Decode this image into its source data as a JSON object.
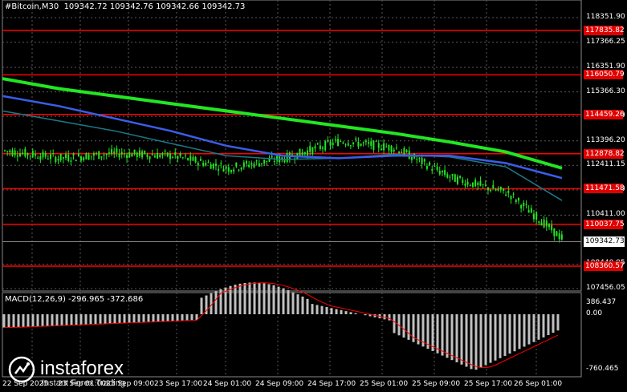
{
  "header": {
    "symbol": "#Bitcoin,M30",
    "ohlc": "109342.72 109342.76 109342.66 109342.73"
  },
  "price_axis": {
    "ticks": [
      "118351.90",
      "117366.25",
      "116351.90",
      "115366.30",
      "114381.30",
      "113396.20",
      "112411.15",
      "111426.10",
      "110411.00",
      "109342.73",
      "108440.95",
      "107456.05"
    ]
  },
  "horizontal_levels": [
    {
      "label": "117835.82",
      "value": 117835.82
    },
    {
      "label": "116050.79",
      "value": 116050.79
    },
    {
      "label": "114459.26",
      "value": 114459.26
    },
    {
      "label": "112878.82",
      "value": 112878.82
    },
    {
      "label": "111471.58",
      "value": 111471.58
    },
    {
      "label": "110037.75",
      "value": 110037.75
    },
    {
      "label": "108360.57",
      "value": 108360.57
    }
  ],
  "current_price": {
    "label": "109342.73",
    "value": 109342.73
  },
  "macd": {
    "title": "MACD(12,26,9) -296.965 -372.686",
    "ticks": [
      "386.437",
      "0.00",
      "-760.465"
    ]
  },
  "time_axis": [
    "22 Sep 2025",
    "23 Sep 01:00",
    "23 Sep 09:00",
    "23 Sep 17:00",
    "24 Sep 01:00",
    "24 Sep 09:00",
    "24 Sep 17:00",
    "25 Sep 01:00",
    "25 Sep 09:00",
    "25 Sep 17:00",
    "26 Sep 01:00"
  ],
  "watermark": {
    "brand": "instaforex",
    "sub": "Instant Forex Trading"
  },
  "colors": {
    "background": "#000000",
    "grid": "#5a5a5a",
    "level": "#ff0000",
    "ma_fast": "#1b7a8a",
    "ma_mid": "#3a5ee8",
    "ma_slow": "#22e622",
    "candles": "#22e622",
    "macd_hist": "#c0c0c0",
    "macd_signal": "#ff0000"
  },
  "chart_data": {
    "type": "line",
    "title": "#Bitcoin,M30",
    "x": [
      "22 Sep 2025",
      "23 Sep 01:00",
      "23 Sep 09:00",
      "23 Sep 17:00",
      "24 Sep 01:00",
      "24 Sep 09:00",
      "24 Sep 17:00",
      "25 Sep 01:00",
      "25 Sep 09:00",
      "25 Sep 17:00",
      "26 Sep 01:00"
    ],
    "ylim": [
      107456.05,
      118351.9
    ],
    "series": [
      {
        "values": [
          113000,
          112700,
          112900,
          112800,
          112300,
          112700,
          113400,
          113100,
          111900,
          111300,
          109400
        ]
      },
      {
        "values": [
          114600,
          114200,
          113800,
          113300,
          112800,
          112650,
          112700,
          112850,
          112750,
          112350,
          111000
        ]
      },
      {
        "values": [
          115200,
          114800,
          114300,
          113800,
          113200,
          112800,
          112700,
          112800,
          112800,
          112500,
          111900
        ]
      },
      {
        "values": [
          115900,
          115500,
          115200,
          114900,
          114600,
          114300,
          114000,
          113700,
          113350,
          112950,
          112300
        ]
      }
    ]
  }
}
